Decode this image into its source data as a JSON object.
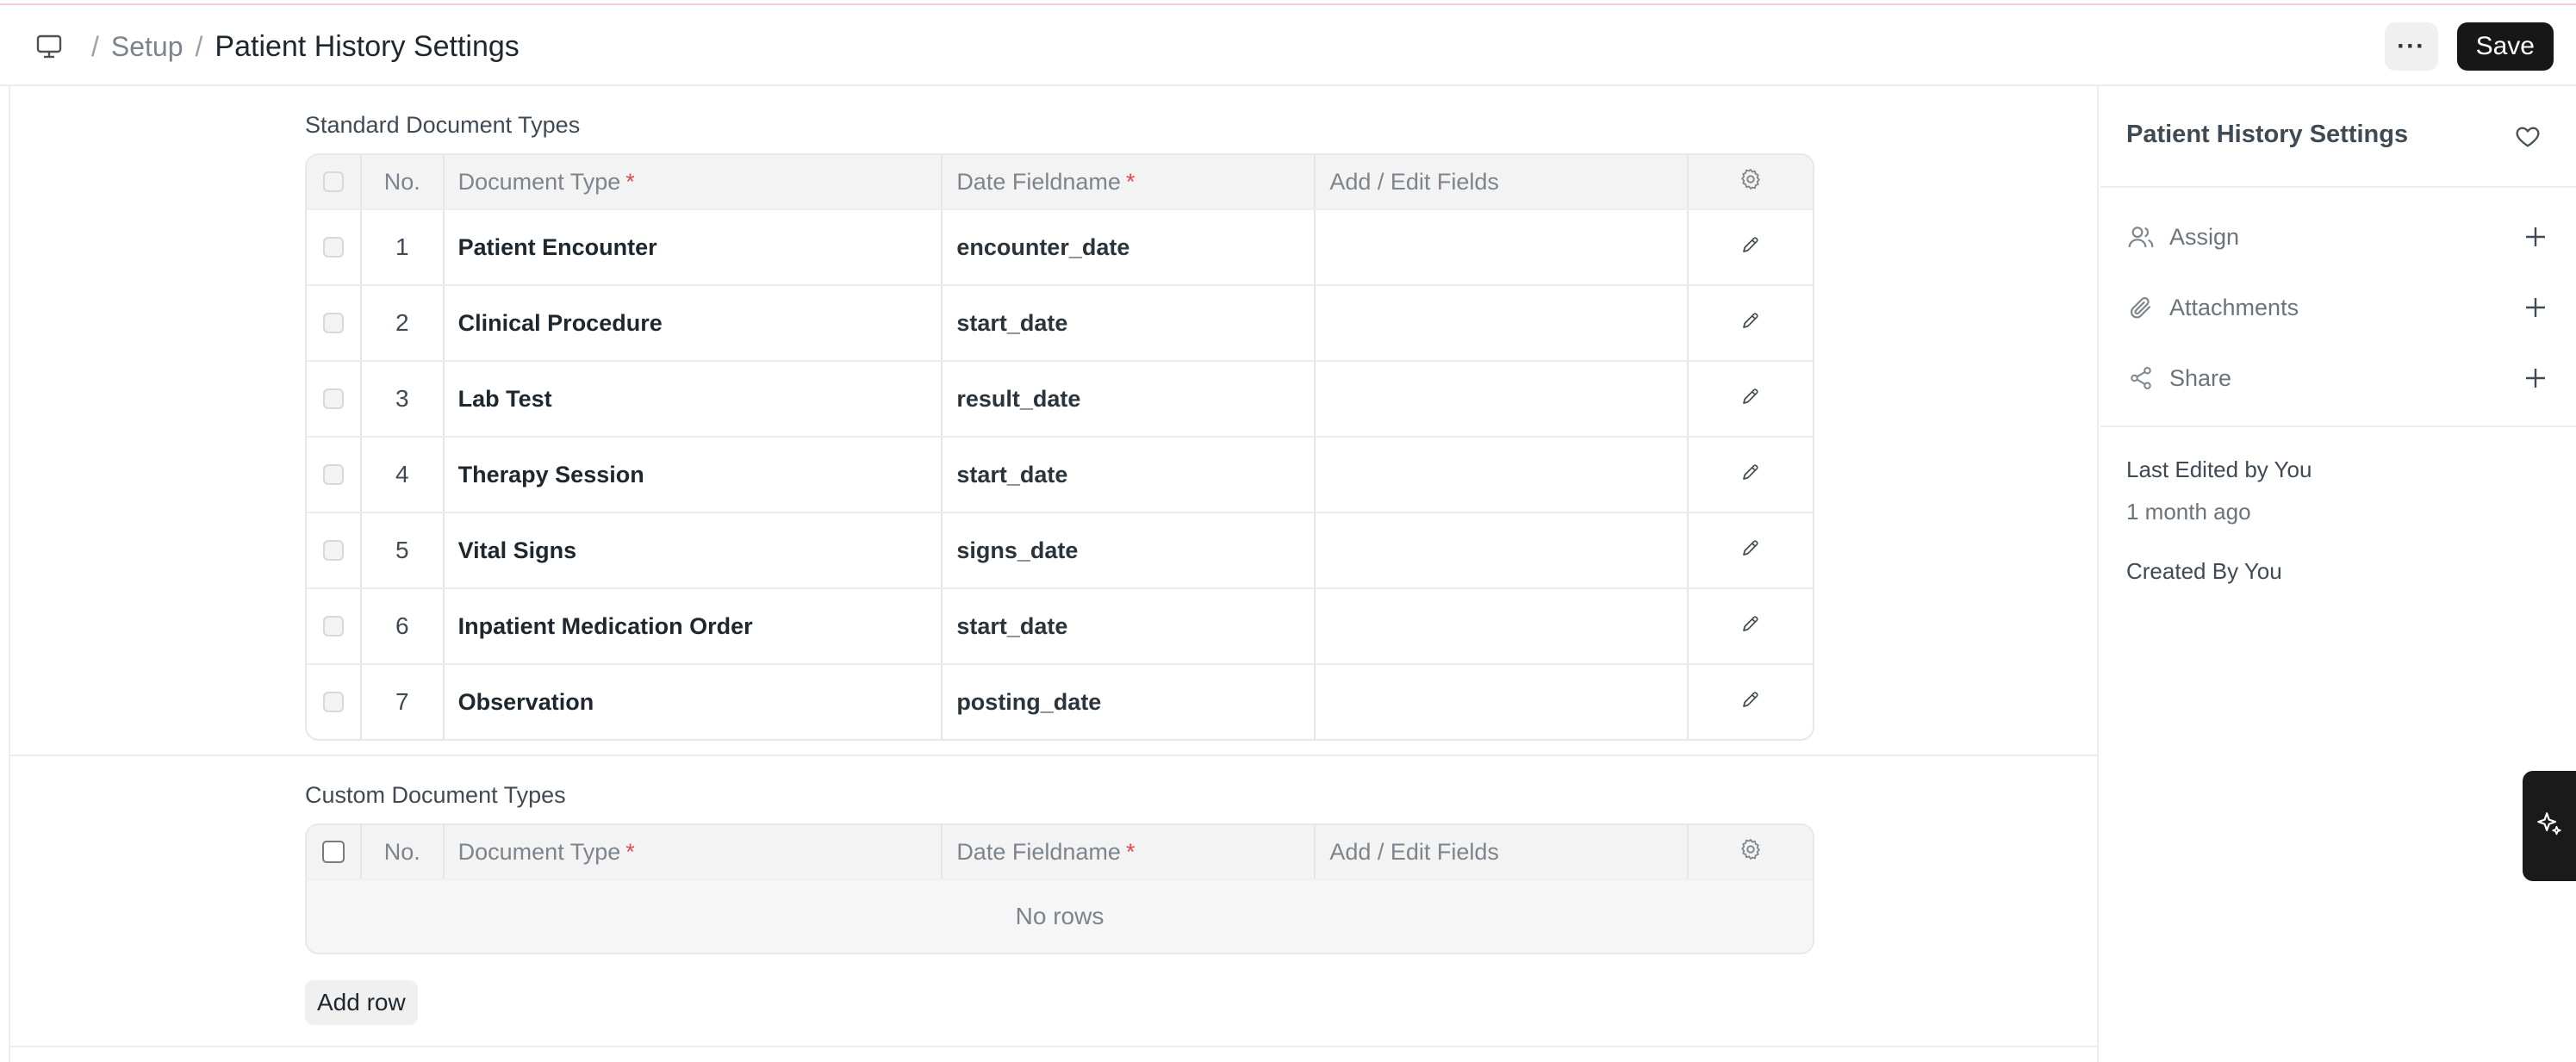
{
  "header": {
    "breadcrumb": [
      "Setup"
    ],
    "title": "Patient History Settings",
    "more_label": "···",
    "save_label": "Save"
  },
  "standard": {
    "label": "Standard Document Types",
    "columns": {
      "no": "No.",
      "doc_type": "Document Type",
      "date_field": "Date Fieldname",
      "add_edit": "Add / Edit Fields",
      "required_mark": "*"
    },
    "rows": [
      {
        "no": "1",
        "doc_type": "Patient Encounter",
        "date_field": "encounter_date"
      },
      {
        "no": "2",
        "doc_type": "Clinical Procedure",
        "date_field": "start_date"
      },
      {
        "no": "3",
        "doc_type": "Lab Test",
        "date_field": "result_date"
      },
      {
        "no": "4",
        "doc_type": "Therapy Session",
        "date_field": "start_date"
      },
      {
        "no": "5",
        "doc_type": "Vital Signs",
        "date_field": "signs_date"
      },
      {
        "no": "6",
        "doc_type": "Inpatient Medication Order",
        "date_field": "start_date"
      },
      {
        "no": "7",
        "doc_type": "Observation",
        "date_field": "posting_date"
      }
    ]
  },
  "custom": {
    "label": "Custom Document Types",
    "columns": {
      "no": "No.",
      "doc_type": "Document Type",
      "date_field": "Date Fieldname",
      "add_edit": "Add / Edit Fields",
      "required_mark": "*"
    },
    "empty_text": "No rows",
    "add_row_label": "Add row"
  },
  "sidebar": {
    "title": "Patient History Settings",
    "items": [
      {
        "label": "Assign",
        "icon": "users-icon"
      },
      {
        "label": "Attachments",
        "icon": "paperclip-icon"
      },
      {
        "label": "Share",
        "icon": "share-icon"
      }
    ],
    "last_edited": "Last Edited by You",
    "last_edited_time": "1 month ago",
    "created_by": "Created By You"
  },
  "colors": {
    "accent_dark": "#171717",
    "required": "#e24c4c",
    "muted_text": "#7c848c"
  }
}
